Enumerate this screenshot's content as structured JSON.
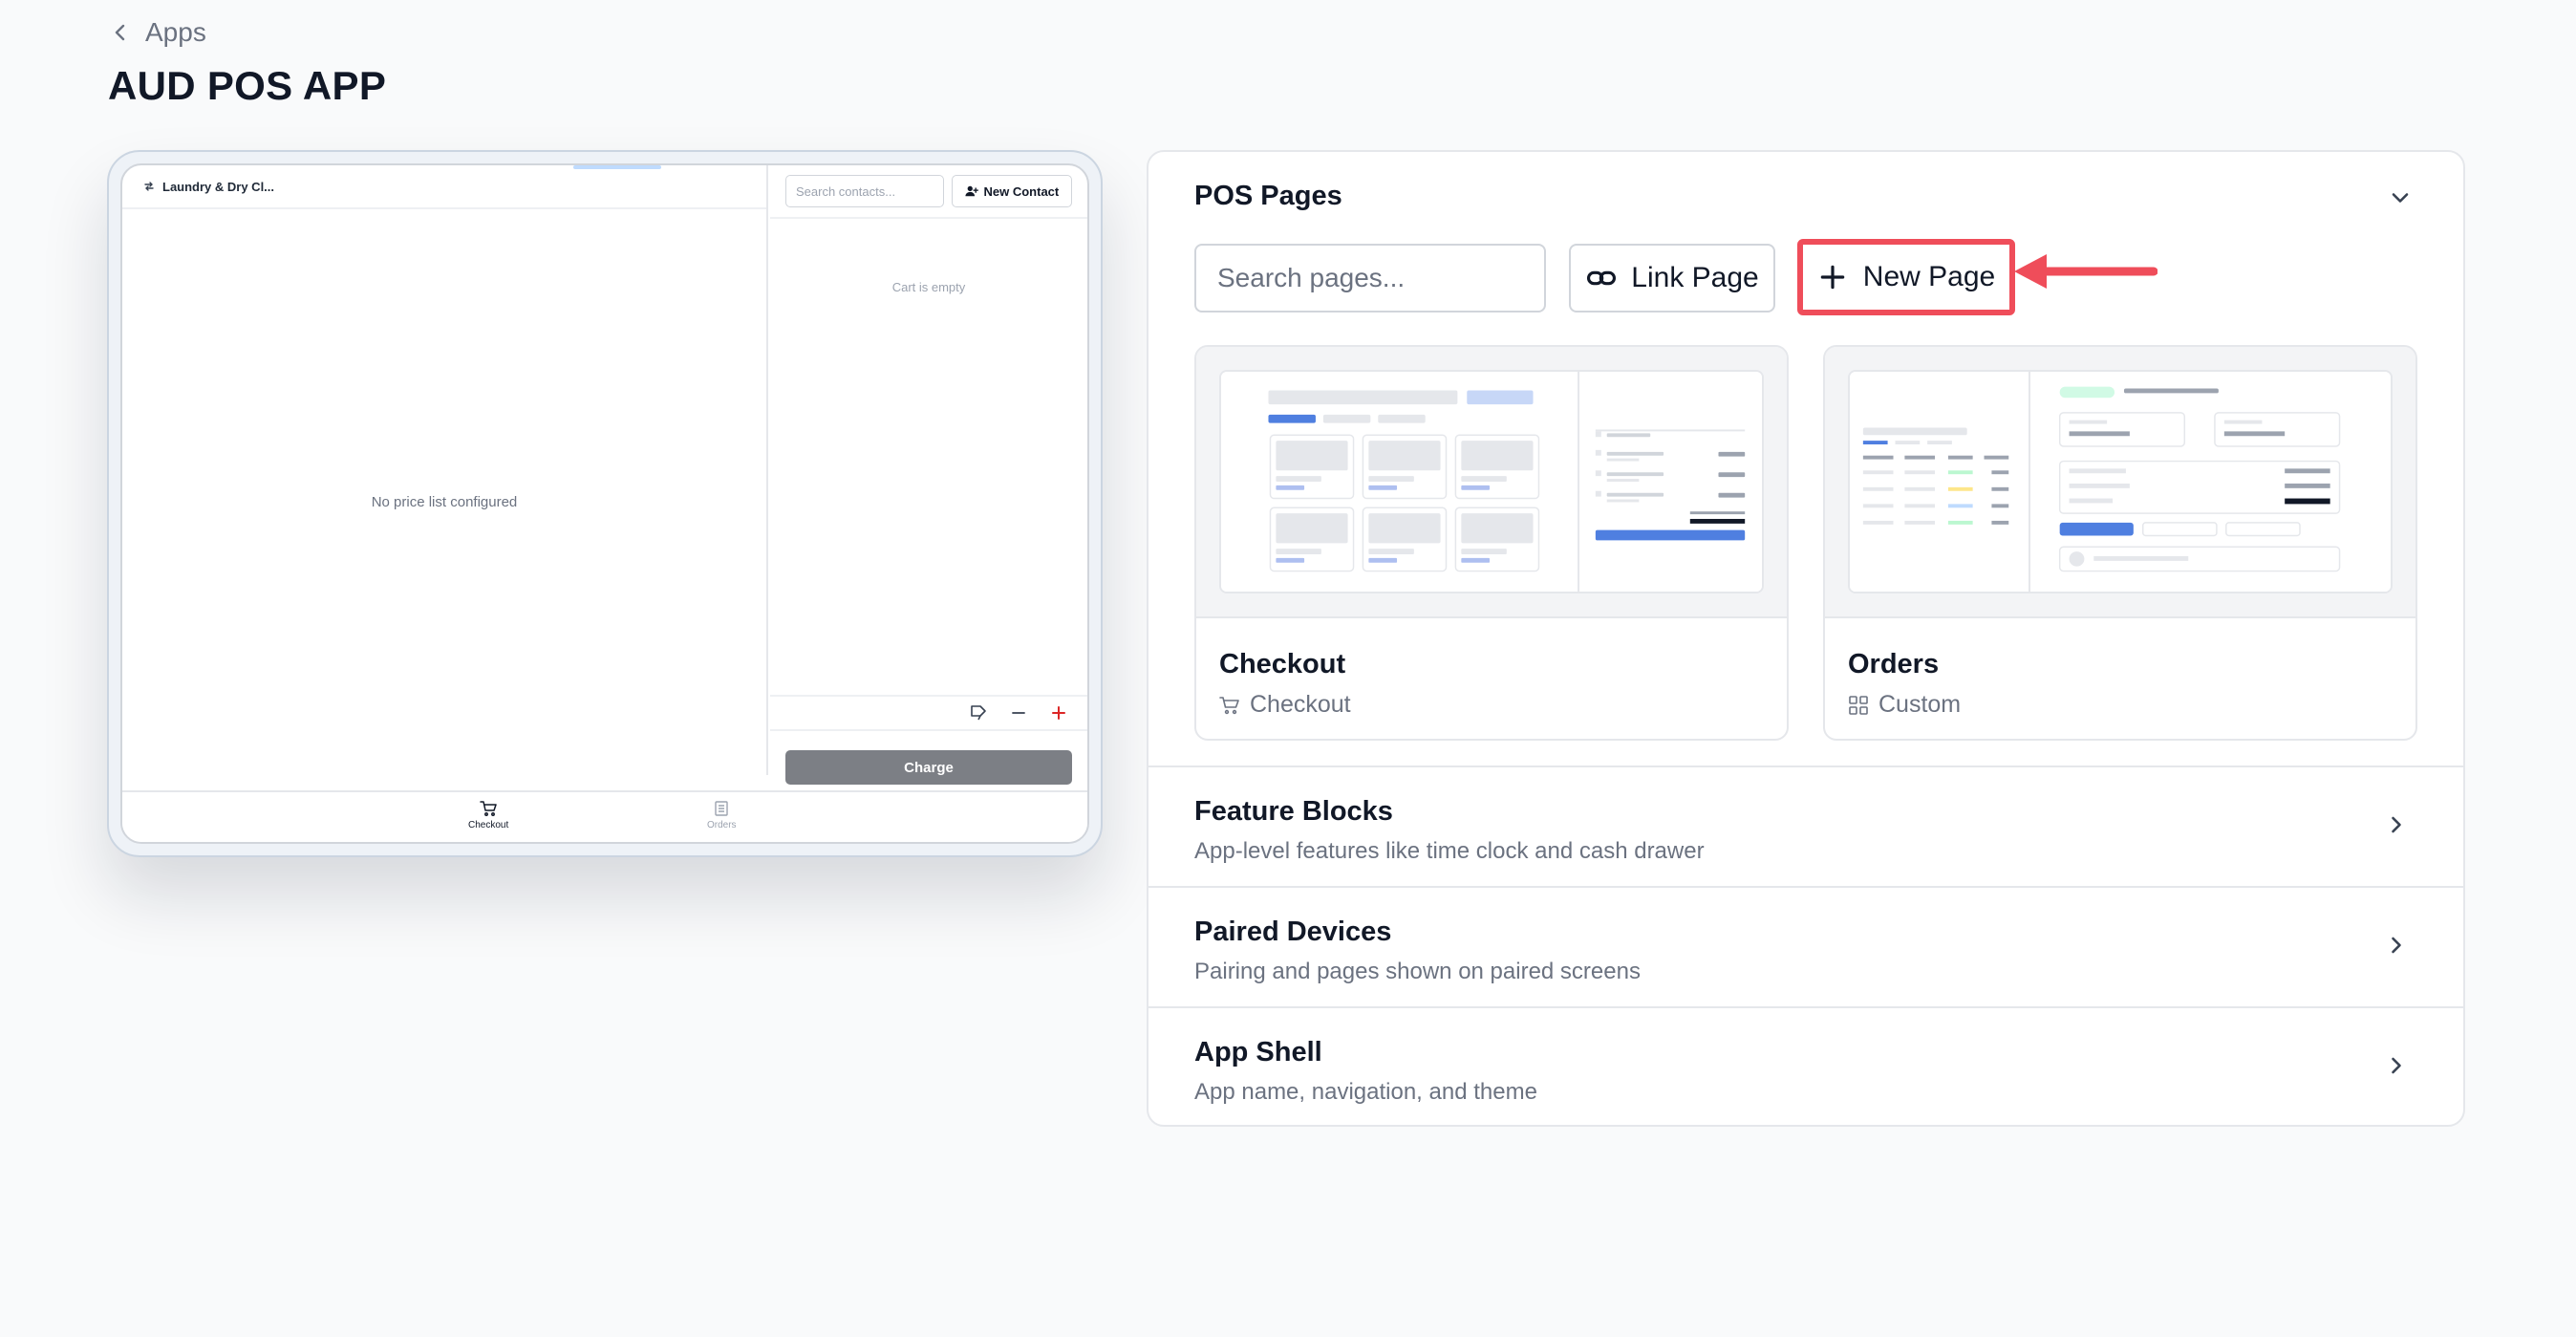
{
  "breadcrumb": {
    "label": "Apps"
  },
  "page": {
    "title": "AUD POS APP"
  },
  "preview": {
    "business_name": "Laundry & Dry Cl...",
    "empty_prices": "No price list configured",
    "contact_search_placeholder": "Search contacts...",
    "new_contact_label": "New Contact",
    "cart_empty": "Cart is empty",
    "charge_label": "Charge",
    "nav": [
      {
        "label": "Checkout",
        "icon": "cart-icon",
        "active": true
      },
      {
        "label": "Orders",
        "icon": "list-icon",
        "active": false
      }
    ]
  },
  "pos_pages": {
    "title": "POS Pages",
    "search_placeholder": "Search pages...",
    "link_page_label": "Link Page",
    "new_page_label": "New Page",
    "cards": [
      {
        "name": "Checkout",
        "type": "Checkout",
        "type_icon": "cart-icon"
      },
      {
        "name": "Orders",
        "type": "Custom",
        "type_icon": "grid-icon"
      }
    ]
  },
  "sections": [
    {
      "title": "Feature Blocks",
      "subtitle": "App-level features like time clock and cash drawer"
    },
    {
      "title": "Paired Devices",
      "subtitle": "Pairing and pages shown on paired screens"
    },
    {
      "title": "App Shell",
      "subtitle": "App name, navigation, and theme"
    }
  ],
  "colors": {
    "accent_blue": "#4f7fe0",
    "highlight_red": "#ef4d5a",
    "charge_gray": "#7c7f85",
    "danger_red": "#dc2626"
  }
}
